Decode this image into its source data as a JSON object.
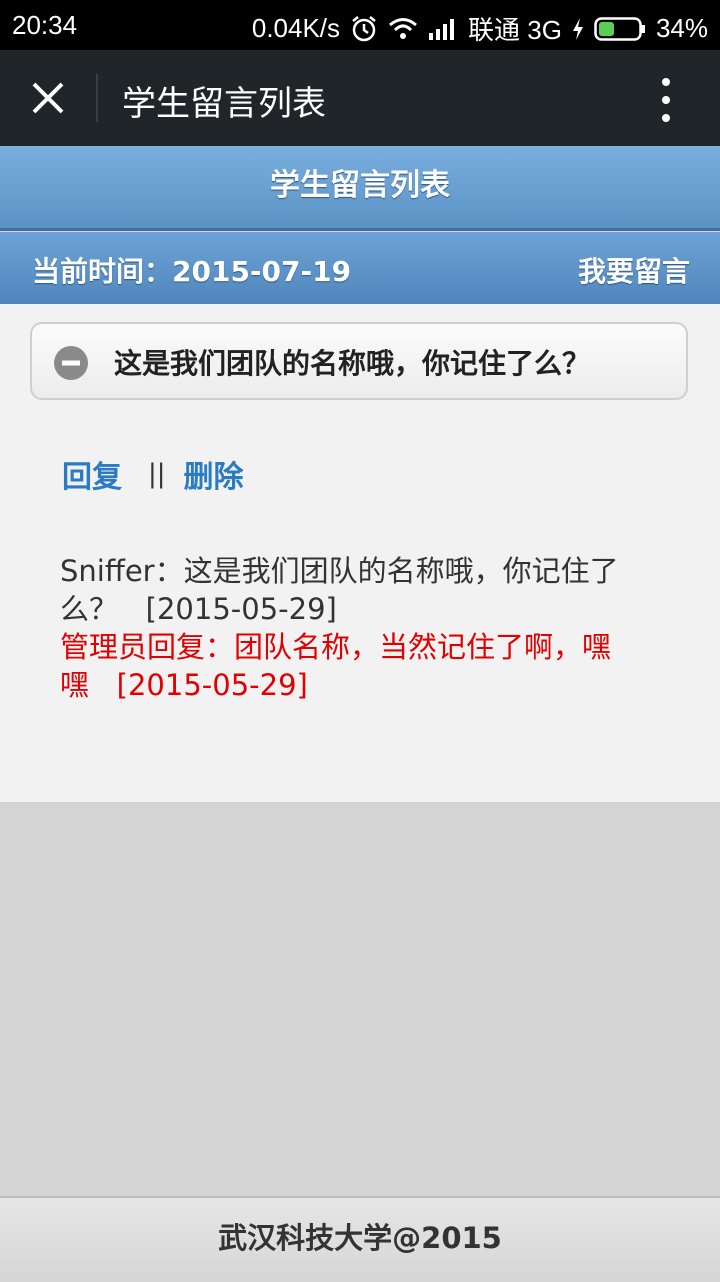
{
  "status_bar": {
    "time": "20:34",
    "speed": "0.04K/s",
    "carrier": "联通 3G",
    "battery": "34%",
    "icons": [
      "alarm-icon",
      "wifi-icon",
      "signal-icon",
      "charging-icon",
      "battery-icon"
    ]
  },
  "wechat_bar": {
    "title": "学生留言列表",
    "close_icon": "close-icon",
    "more_icon": "more-vertical-icon"
  },
  "header": {
    "title": "学生留言列表"
  },
  "info_bar": {
    "current_time": "当前时间：2015-07-19",
    "leave_message": "我要留言"
  },
  "message": {
    "heading": "这是我们团队的名称哦，你记住了么？",
    "reply_link": "回复",
    "separator": "||",
    "delete_link": "删除",
    "author": "Sniffer",
    "body": "：这是我们团队的名称哦，你记住了么？",
    "date": "[2015-05-29]",
    "admin_reply_label": "管理员回复",
    "admin_reply_body": "：团队名称，当然记住了啊，嘿嘿",
    "admin_reply_date": "[2015-05-29]"
  },
  "footer": {
    "text": "武汉科技大学@2015"
  },
  "colors": {
    "header_blue": "#5c93c6",
    "link_blue": "#2a7bc4",
    "reply_red": "#e20000",
    "wechat_bar": "#1f2529"
  }
}
